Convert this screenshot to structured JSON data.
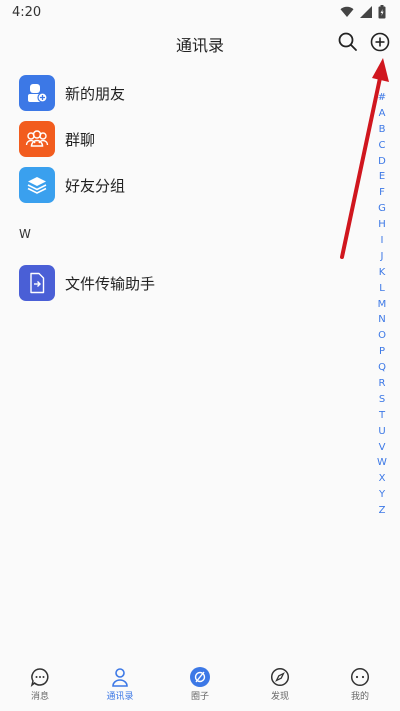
{
  "status_bar": {
    "time": "4:20"
  },
  "header": {
    "title": "通讯录"
  },
  "special_items": [
    {
      "label": "新的朋友",
      "color": "#3c78e6",
      "icon": "new-friend-icon"
    },
    {
      "label": "群聊",
      "color": "#f25c1e",
      "icon": "group-chat-icon"
    },
    {
      "label": "好友分组",
      "color": "#3aa0ee",
      "icon": "friend-group-icon"
    }
  ],
  "sections": [
    {
      "letter": "W",
      "contacts": [
        {
          "label": "文件传输助手",
          "color": "#4a5fd6",
          "icon": "file-transfer-icon"
        }
      ]
    }
  ],
  "index_letters": [
    "#",
    "A",
    "B",
    "C",
    "D",
    "E",
    "F",
    "G",
    "H",
    "I",
    "J",
    "K",
    "L",
    "M",
    "N",
    "O",
    "P",
    "Q",
    "R",
    "S",
    "T",
    "U",
    "V",
    "W",
    "X",
    "Y",
    "Z"
  ],
  "tabs": [
    {
      "label": "消息",
      "icon": "message-icon",
      "active": false
    },
    {
      "label": "通讯录",
      "icon": "contacts-icon",
      "active": true
    },
    {
      "label": "圈子",
      "icon": "circle-icon",
      "active": false
    },
    {
      "label": "发现",
      "icon": "discover-icon",
      "active": false
    },
    {
      "label": "我的",
      "icon": "me-icon",
      "active": false
    }
  ],
  "colors": {
    "accent": "#3c78e6",
    "annotation_arrow": "#d0161e"
  }
}
